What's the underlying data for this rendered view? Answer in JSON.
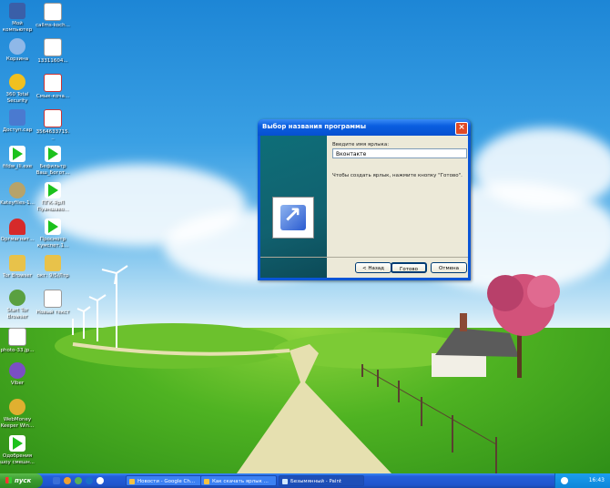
{
  "desktop_icons": [
    {
      "label": "Мой компьютер",
      "icon": "computer-icon"
    },
    {
      "label": "Корзина",
      "icon": "recycle-bin-icon"
    },
    {
      "label": "360 Total Security",
      "icon": "shield-icon"
    },
    {
      "label": "Доступ.сар",
      "icon": "network-icon"
    },
    {
      "label": "fifdw_ili.exe",
      "icon": "play-icon"
    },
    {
      "label": "Kateyfiles-1...",
      "icon": "gem-icon"
    },
    {
      "label": "Оргмагнит...",
      "icon": "magnet-icon"
    },
    {
      "label": "Tor Browser",
      "icon": "folder-icon"
    },
    {
      "label": "Start Tor Browser",
      "icon": "globe-icon"
    },
    {
      "label": "photo-33.jp...",
      "icon": "image-icon"
    },
    {
      "label": "Viber",
      "icon": "viber-icon"
    },
    {
      "label": "WebMoney Keeper Win...",
      "icon": "webmoney-icon"
    },
    {
      "label": "Одобрения шоу смешн...",
      "icon": "play-icon"
    },
    {
      "label": "callms-koch...",
      "icon": "document-icon"
    },
    {
      "label": "13311604...",
      "icon": "document-icon"
    },
    {
      "label": "Смык-коча...",
      "icon": "document-icon"
    },
    {
      "label": "3564633715...",
      "icon": "document-icon"
    },
    {
      "label": "Бефильтр Ваш_Богот...",
      "icon": "play-icon"
    },
    {
      "label": "ПГК-ЯрЛ Пуаншаво...",
      "icon": "play-icon"
    },
    {
      "label": "Просмотр кумспет.1...",
      "icon": "play-icon"
    },
    {
      "label": "окт: 9/5/Лтр",
      "icon": "folder-icon"
    },
    {
      "label": "Новый текст",
      "icon": "text-file-icon"
    }
  ],
  "dialog": {
    "title": "Выбор названия программы",
    "name_label": "Введите имя ярлыка:",
    "name_value": "Вконтакте",
    "hint": "Чтобы создать ярлык, нажмите кнопку \"Готово\".",
    "back_button": "< Назад",
    "finish_button": "Готово",
    "cancel_button": "Отмена"
  },
  "taskbar": {
    "start_label": "пуск",
    "tasks": [
      "Новости - Google Ch...",
      "Как скачать ярлык ...",
      "Безымянный - Paint"
    ],
    "language": "RU",
    "clock": "16:43"
  },
  "colors": {
    "sky_top": "#1d86d6",
    "grass": "#4fb322",
    "titlebar": "#0a5ee0",
    "start_green": "#3a9a2e"
  }
}
